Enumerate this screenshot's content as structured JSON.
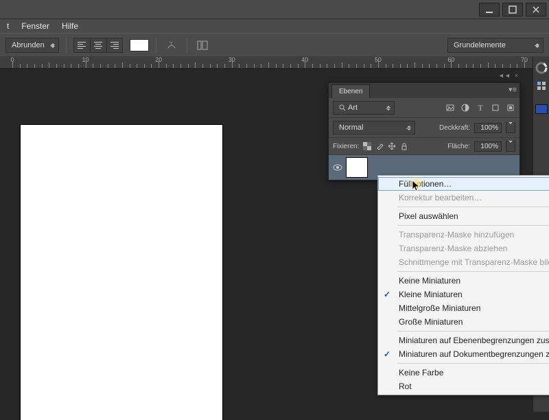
{
  "menubar": {
    "items": [
      "t",
      "Fenster",
      "Hilfe"
    ]
  },
  "optbar": {
    "corner_mode": "Abrunden",
    "preset_dropdown": "Grundelemente"
  },
  "ruler": {
    "start": 0,
    "end": 70,
    "step": 10,
    "labels": [
      "0",
      "10",
      "20",
      "30",
      "40",
      "50",
      "60",
      "70"
    ]
  },
  "panel": {
    "tab": "Ebenen",
    "filter_label": "Art",
    "blend_mode": "Normal",
    "opacity_label": "Deckkraft:",
    "opacity_value": "100%",
    "fill_label": "Fläche:",
    "fill_value": "100%",
    "lock_label": "Fixieren:"
  },
  "context_menu": {
    "items": [
      {
        "label": "Fülloptionen…",
        "state": "hover"
      },
      {
        "label": "Korrektur bearbeiten…",
        "state": "disabled"
      },
      {
        "sep": true
      },
      {
        "label": "Pixel auswählen"
      },
      {
        "sep": true
      },
      {
        "label": "Transparenz-Maske hinzufügen",
        "state": "disabled"
      },
      {
        "label": "Transparenz-Maske abziehen",
        "state": "disabled"
      },
      {
        "label": "Schnittmenge mit Transparenz-Maske bilden",
        "state": "disabled"
      },
      {
        "sep": true
      },
      {
        "label": "Keine Miniaturen"
      },
      {
        "label": "Kleine Miniaturen",
        "checked": true
      },
      {
        "label": "Mittelgroße Miniaturen"
      },
      {
        "label": "Große Miniaturen"
      },
      {
        "sep": true
      },
      {
        "label": "Miniaturen auf Ebenenbegrenzungen zuschneiden"
      },
      {
        "label": "Miniaturen auf Dokumentbegrenzungen zuschneiden",
        "checked": true
      },
      {
        "sep": true
      },
      {
        "label": "Keine Farbe"
      },
      {
        "label": "Rot"
      }
    ]
  }
}
